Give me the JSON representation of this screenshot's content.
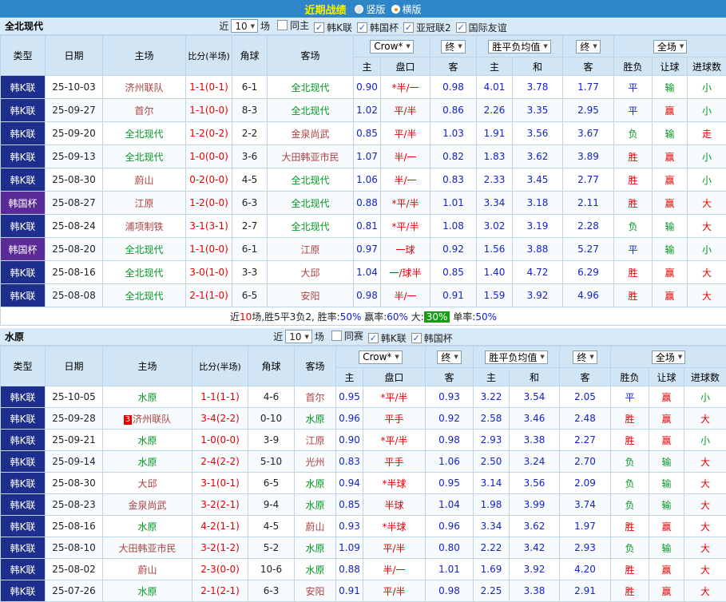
{
  "palette": {
    "red": "#e60000",
    "blue": "#1322cc",
    "green": "#009922",
    "maroon": "#a94442",
    "black": "#222222",
    "white": "#ffffff",
    "navy_bg": "#1d2e8c",
    "purple_bg": "#5a2a96",
    "green_bg": "#13a113"
  },
  "header": {
    "title": "近期战绩",
    "radios": [
      {
        "label": "竖版",
        "selected": false
      },
      {
        "label": "横版",
        "selected": true
      }
    ]
  },
  "filter_labels": {
    "near": "近",
    "matches": "场"
  },
  "table_header": {
    "type": "类型",
    "date": "日期",
    "home": "主场",
    "score": "比分(半场)",
    "corner": "角球",
    "away": "客场",
    "odds_company": "Crow*",
    "odds_final": "终",
    "avg_label": "胜平负均值",
    "avg_final": "终",
    "scope": "全场",
    "sub_home": "主",
    "sub_handicap": "盘口",
    "sub_away": "客",
    "sub_avg_home": "主",
    "sub_avg_draw": "和",
    "sub_avg_away": "客",
    "sub_wdl": "胜负",
    "sub_let": "让球",
    "sub_goals": "进球数"
  },
  "sections": [
    {
      "team": "全北现代",
      "count": "10",
      "checkboxes": [
        {
          "label": "同主",
          "checked": false
        },
        {
          "label": "韩K联",
          "checked": true
        },
        {
          "label": "韩国杯",
          "checked": true
        },
        {
          "label": "亚冠联2",
          "checked": true
        },
        {
          "label": "国际友谊",
          "checked": true
        }
      ],
      "rows": [
        {
          "type": "韩K联",
          "type_bg": "navy_bg",
          "date": "25-10-03",
          "home": "济州联队",
          "home_color": "maroon",
          "score": "1-1(0-1)",
          "corner": "6-1",
          "away": "全北现代",
          "away_color": "green",
          "odds": [
            "0.90",
            "*半/一",
            "0.98"
          ],
          "avg": [
            "4.01",
            "3.78",
            "1.77"
          ],
          "res": [
            [
              "平",
              "blue"
            ],
            [
              "输",
              "green"
            ],
            [
              "小",
              "green"
            ]
          ]
        },
        {
          "type": "韩K联",
          "type_bg": "navy_bg",
          "date": "25-09-27",
          "home": "首尔",
          "home_color": "maroon",
          "score": "1-1(0-0)",
          "corner": "8-3",
          "away": "全北现代",
          "away_color": "green",
          "odds": [
            "1.02",
            "平/半",
            "0.86"
          ],
          "avg": [
            "2.26",
            "3.35",
            "2.95"
          ],
          "res": [
            [
              "平",
              "blue"
            ],
            [
              "赢",
              "red"
            ],
            [
              "小",
              "green"
            ]
          ]
        },
        {
          "type": "韩K联",
          "type_bg": "navy_bg",
          "date": "25-09-20",
          "home": "全北现代",
          "home_color": "green",
          "score": "1-2(0-2)",
          "corner": "2-2",
          "away": "金泉尚武",
          "away_color": "maroon",
          "odds": [
            "0.85",
            "平/半",
            "1.03"
          ],
          "avg": [
            "1.91",
            "3.56",
            "3.67"
          ],
          "res": [
            [
              "负",
              "green"
            ],
            [
              "输",
              "green"
            ],
            [
              "走",
              "red"
            ]
          ]
        },
        {
          "type": "韩K联",
          "type_bg": "navy_bg",
          "date": "25-09-13",
          "home": "全北现代",
          "home_color": "green",
          "score": "1-0(0-0)",
          "corner": "3-6",
          "away": "大田韩亚市民",
          "away_color": "maroon",
          "odds": [
            "1.07",
            "半/一",
            "0.82"
          ],
          "avg": [
            "1.83",
            "3.62",
            "3.89"
          ],
          "res": [
            [
              "胜",
              "red"
            ],
            [
              "赢",
              "red"
            ],
            [
              "小",
              "green"
            ]
          ]
        },
        {
          "type": "韩K联",
          "type_bg": "navy_bg",
          "date": "25-08-30",
          "home": "蔚山",
          "home_color": "maroon",
          "score": "0-2(0-0)",
          "corner": "4-5",
          "away": "全北现代",
          "away_color": "green",
          "odds": [
            "1.06",
            "半/一",
            "0.83"
          ],
          "avg": [
            "2.33",
            "3.45",
            "2.77"
          ],
          "res": [
            [
              "胜",
              "red"
            ],
            [
              "赢",
              "red"
            ],
            [
              "小",
              "green"
            ]
          ]
        },
        {
          "type": "韩国杯",
          "type_bg": "purple_bg",
          "date": "25-08-27",
          "home": "江原",
          "home_color": "maroon",
          "score": "1-2(0-0)",
          "corner": "6-3",
          "away": "全北现代",
          "away_color": "green",
          "odds": [
            "0.88",
            "*平/半",
            "1.01"
          ],
          "avg": [
            "3.34",
            "3.18",
            "2.11"
          ],
          "res": [
            [
              "胜",
              "red"
            ],
            [
              "赢",
              "red"
            ],
            [
              "大",
              "red"
            ]
          ]
        },
        {
          "type": "韩K联",
          "type_bg": "navy_bg",
          "date": "25-08-24",
          "home": "浦项制铁",
          "home_color": "maroon",
          "score": "3-1(3-1)",
          "corner": "2-7",
          "away": "全北现代",
          "away_color": "green",
          "odds": [
            "0.81",
            "*平/半",
            "1.08"
          ],
          "avg": [
            "3.02",
            "3.19",
            "2.28"
          ],
          "res": [
            [
              "负",
              "green"
            ],
            [
              "输",
              "green"
            ],
            [
              "大",
              "red"
            ]
          ]
        },
        {
          "type": "韩国杯",
          "type_bg": "purple_bg",
          "date": "25-08-20",
          "home": "全北现代",
          "home_color": "green",
          "score": "1-1(0-0)",
          "corner": "6-1",
          "away": "江原",
          "away_color": "maroon",
          "odds": [
            "0.97",
            "一球",
            "0.92"
          ],
          "avg": [
            "1.56",
            "3.88",
            "5.27"
          ],
          "res": [
            [
              "平",
              "blue"
            ],
            [
              "输",
              "green"
            ],
            [
              "小",
              "green"
            ]
          ]
        },
        {
          "type": "韩K联",
          "type_bg": "navy_bg",
          "date": "25-08-16",
          "home": "全北现代",
          "home_color": "green",
          "score": "3-0(1-0)",
          "corner": "3-3",
          "away": "大邱",
          "away_color": "maroon",
          "odds": [
            "1.04",
            "一/球半",
            "0.85"
          ],
          "avg": [
            "1.40",
            "4.72",
            "6.29"
          ],
          "res": [
            [
              "胜",
              "red"
            ],
            [
              "赢",
              "red"
            ],
            [
              "大",
              "red"
            ]
          ]
        },
        {
          "type": "韩K联",
          "type_bg": "navy_bg",
          "date": "25-08-08",
          "home": "全北现代",
          "home_color": "green",
          "score": "2-1(1-0)",
          "corner": "6-5",
          "away": "安阳",
          "away_color": "maroon",
          "odds": [
            "0.98",
            "半/一",
            "0.91"
          ],
          "avg": [
            "1.59",
            "3.92",
            "4.96"
          ],
          "res": [
            [
              "胜",
              "red"
            ],
            [
              "赢",
              "red"
            ],
            [
              "大",
              "red"
            ]
          ]
        }
      ],
      "summary": [
        {
          "text": "近",
          "color": "black"
        },
        {
          "text": "10",
          "color": "red"
        },
        {
          "text": "场,胜5平3负2, ",
          "color": "black"
        },
        {
          "text": "胜率:",
          "color": "black"
        },
        {
          "text": "50%",
          "color": "blue"
        },
        {
          "text": " 赢率:",
          "color": "black"
        },
        {
          "text": "60%",
          "color": "blue"
        },
        {
          "text": " 大:",
          "color": "black"
        },
        {
          "text": "30%",
          "color": "white",
          "bg": "green_bg"
        },
        {
          "text": " 单率:",
          "color": "black"
        },
        {
          "text": "50%",
          "color": "blue"
        }
      ]
    },
    {
      "team": "水原",
      "count": "10",
      "checkboxes": [
        {
          "label": "同赛",
          "checked": false
        },
        {
          "label": "韩K联",
          "checked": true
        },
        {
          "label": "韩国杯",
          "checked": true
        }
      ],
      "rows": [
        {
          "type": "韩K联",
          "type_bg": "navy_bg",
          "date": "25-10-05",
          "home": "水原",
          "home_color": "green",
          "score": "1-1(1-1)",
          "corner": "4-6",
          "away": "首尔",
          "away_color": "maroon",
          "odds": [
            "0.95",
            "*平/半",
            "0.93"
          ],
          "avg": [
            "3.22",
            "3.54",
            "2.05"
          ],
          "res": [
            [
              "平",
              "blue"
            ],
            [
              "赢",
              "red"
            ],
            [
              "小",
              "green"
            ]
          ]
        },
        {
          "type": "韩K联",
          "type_bg": "navy_bg",
          "date": "25-09-28",
          "home": "济州联队",
          "home_color": "maroon",
          "home_badge": "3",
          "score": "3-4(2-2)",
          "corner": "0-10",
          "away": "水原",
          "away_color": "green",
          "odds": [
            "0.96",
            "平手",
            "0.92"
          ],
          "avg": [
            "2.58",
            "3.46",
            "2.48"
          ],
          "res": [
            [
              "胜",
              "red"
            ],
            [
              "赢",
              "red"
            ],
            [
              "大",
              "red"
            ]
          ]
        },
        {
          "type": "韩K联",
          "type_bg": "navy_bg",
          "date": "25-09-21",
          "home": "水原",
          "home_color": "green",
          "score": "1-0(0-0)",
          "corner": "3-9",
          "away": "江原",
          "away_color": "maroon",
          "odds": [
            "0.90",
            "*平/半",
            "0.98"
          ],
          "avg": [
            "2.93",
            "3.38",
            "2.27"
          ],
          "res": [
            [
              "胜",
              "red"
            ],
            [
              "赢",
              "red"
            ],
            [
              "小",
              "green"
            ]
          ]
        },
        {
          "type": "韩K联",
          "type_bg": "navy_bg",
          "date": "25-09-14",
          "home": "水原",
          "home_color": "green",
          "score": "2-4(2-2)",
          "corner": "5-10",
          "away": "光州",
          "away_color": "maroon",
          "odds": [
            "0.83",
            "平手",
            "1.06"
          ],
          "avg": [
            "2.50",
            "3.24",
            "2.70"
          ],
          "res": [
            [
              "负",
              "green"
            ],
            [
              "输",
              "green"
            ],
            [
              "大",
              "red"
            ]
          ]
        },
        {
          "type": "韩K联",
          "type_bg": "navy_bg",
          "date": "25-08-30",
          "home": "大邱",
          "home_color": "maroon",
          "score": "3-1(0-1)",
          "corner": "6-5",
          "away": "水原",
          "away_color": "green",
          "odds": [
            "0.94",
            "*半球",
            "0.95"
          ],
          "avg": [
            "3.14",
            "3.56",
            "2.09"
          ],
          "res": [
            [
              "负",
              "green"
            ],
            [
              "输",
              "green"
            ],
            [
              "大",
              "red"
            ]
          ]
        },
        {
          "type": "韩K联",
          "type_bg": "navy_bg",
          "date": "25-08-23",
          "home": "金泉尚武",
          "home_color": "maroon",
          "score": "3-2(2-1)",
          "corner": "9-4",
          "away": "水原",
          "away_color": "green",
          "odds": [
            "0.85",
            "半球",
            "1.04"
          ],
          "avg": [
            "1.98",
            "3.99",
            "3.74"
          ],
          "res": [
            [
              "负",
              "green"
            ],
            [
              "输",
              "green"
            ],
            [
              "大",
              "red"
            ]
          ]
        },
        {
          "type": "韩K联",
          "type_bg": "navy_bg",
          "date": "25-08-16",
          "home": "水原",
          "home_color": "green",
          "score": "4-2(1-1)",
          "corner": "4-5",
          "away": "蔚山",
          "away_color": "maroon",
          "odds": [
            "0.93",
            "*半球",
            "0.96"
          ],
          "avg": [
            "3.34",
            "3.62",
            "1.97"
          ],
          "res": [
            [
              "胜",
              "red"
            ],
            [
              "赢",
              "red"
            ],
            [
              "大",
              "red"
            ]
          ]
        },
        {
          "type": "韩K联",
          "type_bg": "navy_bg",
          "date": "25-08-10",
          "home": "大田韩亚市民",
          "home_color": "maroon",
          "score": "3-2(1-2)",
          "corner": "5-2",
          "away": "水原",
          "away_color": "green",
          "odds": [
            "1.09",
            "平/半",
            "0.80"
          ],
          "avg": [
            "2.22",
            "3.42",
            "2.93"
          ],
          "res": [
            [
              "负",
              "green"
            ],
            [
              "输",
              "green"
            ],
            [
              "大",
              "red"
            ]
          ]
        },
        {
          "type": "韩K联",
          "type_bg": "navy_bg",
          "date": "25-08-02",
          "home": "蔚山",
          "home_color": "maroon",
          "score": "2-3(0-0)",
          "corner": "10-6",
          "away": "水原",
          "away_color": "green",
          "odds": [
            "0.88",
            "半/一",
            "1.01"
          ],
          "avg": [
            "1.69",
            "3.92",
            "4.20"
          ],
          "res": [
            [
              "胜",
              "red"
            ],
            [
              "赢",
              "red"
            ],
            [
              "大",
              "red"
            ]
          ]
        },
        {
          "type": "韩K联",
          "type_bg": "navy_bg",
          "date": "25-07-26",
          "home": "水原",
          "home_color": "green",
          "score": "2-1(2-1)",
          "corner": "6-3",
          "away": "安阳",
          "away_color": "maroon",
          "odds": [
            "0.91",
            "平/半",
            "0.98"
          ],
          "avg": [
            "2.25",
            "3.38",
            "2.91"
          ],
          "res": [
            [
              "胜",
              "red"
            ],
            [
              "赢",
              "red"
            ],
            [
              "大",
              "red"
            ]
          ]
        }
      ]
    }
  ]
}
